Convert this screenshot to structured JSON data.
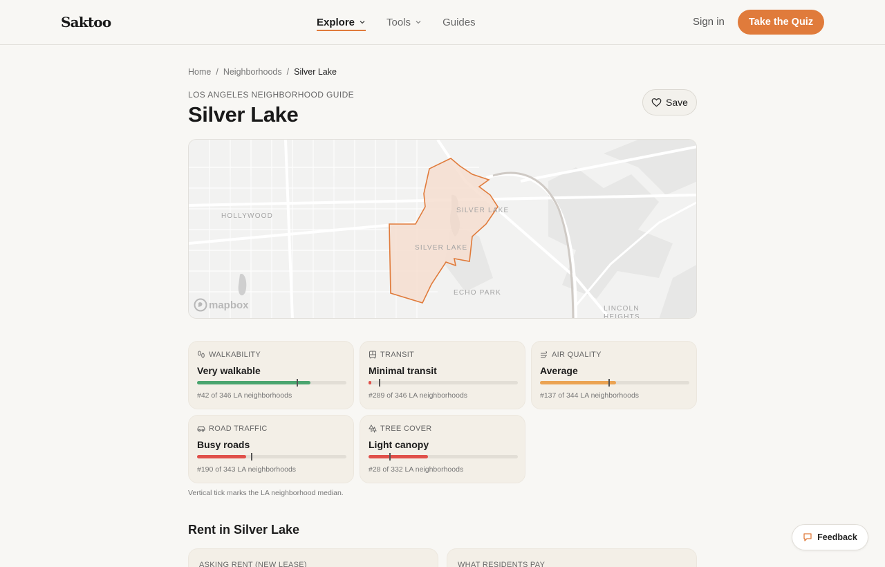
{
  "brand": {
    "logo": "Saktoo"
  },
  "nav": {
    "items": [
      {
        "label": "Explore",
        "dropdown": true,
        "active": true
      },
      {
        "label": "Tools",
        "dropdown": true,
        "active": false
      },
      {
        "label": "Guides",
        "dropdown": false,
        "active": false
      }
    ],
    "sign_in": "Sign in",
    "cta": "Take the Quiz"
  },
  "breadcrumb": {
    "items": [
      "Home",
      "Neighborhoods",
      "Silver Lake"
    ],
    "separator": "/"
  },
  "page": {
    "eyebrow": "LOS ANGELES NEIGHBORHOOD GUIDE",
    "title": "Silver Lake",
    "save_label": "Save"
  },
  "map": {
    "labels": [
      "HOLLYWOOD",
      "SILVER LAKE",
      "SILVER LAKE",
      "ECHO PARK",
      "LINCOLN",
      "HEIGHTS"
    ],
    "attribution": "mapbox",
    "highlight_color": "#e07b3b"
  },
  "metrics": [
    {
      "category": "WALKABILITY",
      "icon": "footsteps-icon",
      "value": "Very walkable",
      "rank": "#42 of 346 LA neighborhoods",
      "fill": 0.76,
      "median": 0.665,
      "color": "#4aa56f"
    },
    {
      "category": "TRANSIT",
      "icon": "bus-icon",
      "value": "Minimal transit",
      "rank": "#289 of 346 LA neighborhoods",
      "fill": 0.02,
      "median": 0.07,
      "color": "#e0504a"
    },
    {
      "category": "AIR QUALITY",
      "icon": "wind-icon",
      "value": "Average",
      "rank": "#137 of 344 LA neighborhoods",
      "fill": 0.51,
      "median": 0.46,
      "color": "#eba353"
    },
    {
      "category": "ROAD TRAFFIC",
      "icon": "car-icon",
      "value": "Busy roads",
      "rank": "#190 of 343 LA neighborhoods",
      "fill": 0.33,
      "median": 0.36,
      "color": "#e0504a"
    },
    {
      "category": "TREE COVER",
      "icon": "trees-icon",
      "value": "Light canopy",
      "rank": "#28 of 332 LA neighborhoods",
      "fill": 0.4,
      "median": 0.14,
      "color": "#e0504a"
    }
  ],
  "metrics_note": "Vertical tick marks the LA neighborhood median.",
  "rent": {
    "title": "Rent in Silver Lake",
    "cards": [
      {
        "label": "ASKING RENT (NEW LEASE)"
      },
      {
        "label": "WHAT RESIDENTS PAY"
      }
    ]
  },
  "feedback": {
    "label": "Feedback"
  },
  "colors": {
    "accent": "#e07b3b",
    "background": "#f8f7f4",
    "card": "#f3efe7"
  }
}
